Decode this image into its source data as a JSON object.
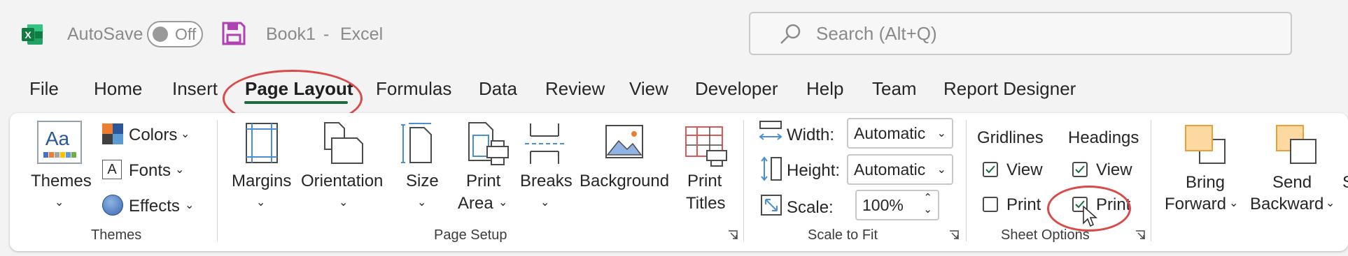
{
  "titlebar": {
    "app_icon": "excel-icon",
    "autosave_label": "AutoSave",
    "autosave_state": "Off",
    "save_icon": "save-icon",
    "book_name": "Book1",
    "separator": "-",
    "app_name": "Excel",
    "search_placeholder": "Search (Alt+Q)"
  },
  "menu": {
    "file": "File",
    "home": "Home",
    "insert": "Insert",
    "page_layout": "Page Layout",
    "formulas": "Formulas",
    "data": "Data",
    "review": "Review",
    "view": "View",
    "developer": "Developer",
    "help": "Help",
    "team": "Team",
    "report_designer": "Report Designer"
  },
  "ribbon": {
    "themes_group": {
      "themes": "Themes",
      "colors": "Colors",
      "fonts": "Fonts",
      "effects": "Effects",
      "group_label": "Themes"
    },
    "page_setup_group": {
      "margins": "Margins",
      "orientation": "Orientation",
      "size": "Size",
      "print_area_1": "Print",
      "print_area_2": "Area",
      "breaks": "Breaks",
      "background": "Background",
      "print_titles_1": "Print",
      "print_titles_2": "Titles",
      "group_label": "Page Setup"
    },
    "scale_group": {
      "width_label": "Width:",
      "width_value": "Automatic",
      "height_label": "Height:",
      "height_value": "Automatic",
      "scale_label": "Scale:",
      "scale_value": "100%",
      "group_label": "Scale to Fit"
    },
    "sheet_options_group": {
      "gridlines": "Gridlines",
      "headings": "Headings",
      "view": "View",
      "print": "Print",
      "gridlines_view_checked": true,
      "gridlines_print_checked": false,
      "headings_view_checked": true,
      "headings_print_checked": true,
      "group_label": "Sheet Options"
    },
    "arrange_group": {
      "bring_1": "Bring",
      "bring_2": "Forward",
      "send_1": "Send",
      "send_2": "Backward",
      "partial": "S"
    }
  },
  "colors": {
    "accent_green": "#1e6b3d",
    "annotation_red": "#d94a4a",
    "excel_green": "#107c41"
  }
}
